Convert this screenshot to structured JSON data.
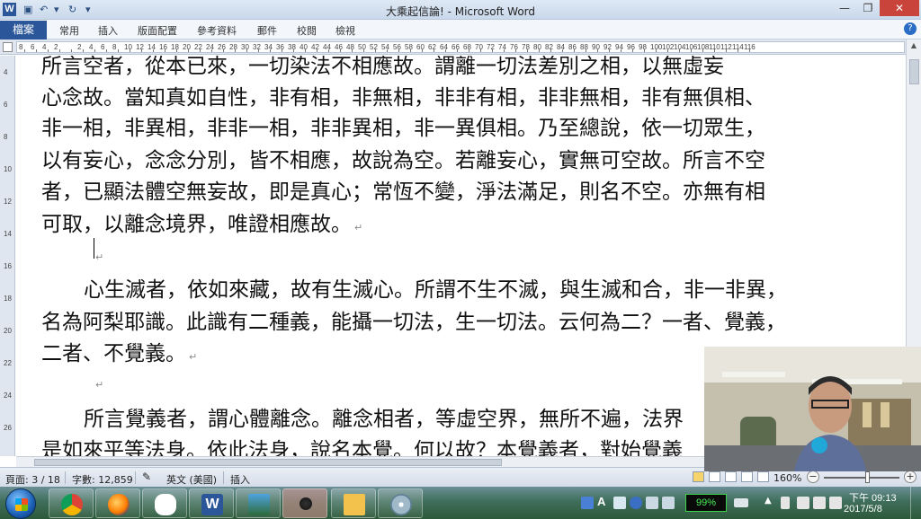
{
  "window": {
    "title": "大乘起信論! - Microsoft Word",
    "minimize": "—",
    "restore": "❐",
    "close": "✕"
  },
  "quick_access": {
    "save_icon": "save-icon",
    "undo_icon": "undo-icon",
    "redo_icon": "redo-icon"
  },
  "ribbon": {
    "file_tab": "檔案",
    "tabs": [
      "常用",
      "插入",
      "版面配置",
      "參考資料",
      "郵件",
      "校閱",
      "檢視"
    ],
    "help": "?"
  },
  "ruler": {
    "numbers": [
      "8",
      "6",
      "4",
      "2",
      "",
      "2",
      "4",
      "6",
      "8",
      "10",
      "12",
      "14",
      "16",
      "18",
      "20",
      "22",
      "24",
      "26",
      "28",
      "30",
      "32",
      "34",
      "36",
      "38",
      "40",
      "42",
      "44",
      "46",
      "48",
      "50",
      "52",
      "54",
      "56",
      "58",
      "60",
      "62",
      "64",
      "66",
      "68",
      "70",
      "72",
      "74",
      "76",
      "78",
      "80",
      "82",
      "84",
      "86",
      "88",
      "90",
      "92",
      "94",
      "96",
      "98",
      "100",
      "102",
      "104",
      "106",
      "108",
      "110",
      "112",
      "114",
      "116"
    ]
  },
  "vertical_ruler": {
    "numbers": [
      "4",
      "6",
      "8",
      "10",
      "12",
      "14",
      "16",
      "18",
      "20",
      "22",
      "24",
      "26"
    ]
  },
  "document": {
    "lines": [
      "所言空者，從本已來，一切染法不相應故。謂離一切法差別之相，以無虛妄",
      "心念故。當知真如自性，非有相，非無相，非非有相，非非無相，非有無俱相、",
      "非一相，非異相，非非一相，非非異相，非一異俱相。乃至總說，依一切眾生，",
      "以有妄心，念念分別，皆不相應，故說為空。若離妄心，實無可空故。所言不空",
      "者，已顯法體空無妄故，即是真心；常恆不變，淨法滿足，則名不空。亦無有相",
      "可取，以離念境界，唯證相應故。",
      "心生滅者，依如來藏，故有生滅心。所謂不生不滅，與生滅和合，非一非異，",
      "名為阿梨耶識。此識有二種義，能攝一切法，生一切法。云何為二？一者、覺義，",
      "二者、不覺義。",
      "所言覺義者，謂心體離念。離念相者，等虛空界，無所不遍，法界",
      "是如來平等法身。依此法身，說名本覺。何以故？本覺義者，對始覺義"
    ],
    "paragraph_mark": "↵"
  },
  "status_bar": {
    "page": "頁面: 3 / 18",
    "words": "字數: 12,859",
    "language": "英文 (美國)",
    "mode": "插入",
    "zoom": "160%",
    "zoom_minus": "−",
    "zoom_plus": "+"
  },
  "taskbar": {
    "apps": [
      "chrome-icon",
      "firefox-icon",
      "wechat-icon",
      "word-icon",
      "photo-viewer-icon",
      "microphone-recorder-icon",
      "file-explorer-icon",
      "media-disc-icon"
    ],
    "battery": "99%",
    "clock_time": "下午 09:13",
    "clock_date": "2017/5/8"
  },
  "colors": {
    "word_blue": "#2b579a",
    "squiggle_green": "#2eaa3b",
    "squiggle_red": "#d8302a",
    "battery_green": "#4bf05a"
  }
}
